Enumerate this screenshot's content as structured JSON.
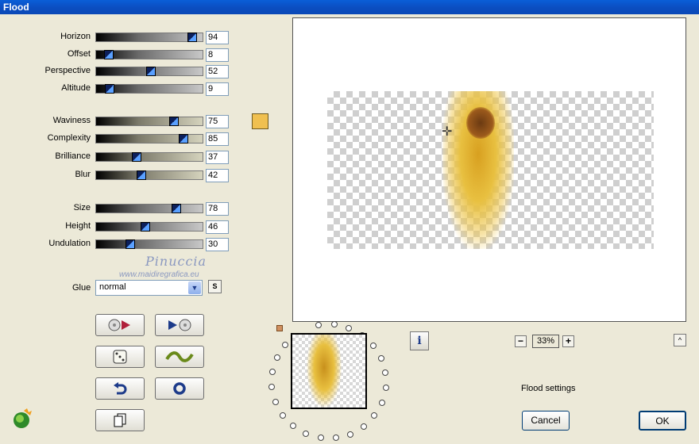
{
  "window": {
    "title": "Flood"
  },
  "sliders_group1": [
    {
      "label": "Horizon",
      "value": "94",
      "level": 0.94,
      "style": "gray"
    },
    {
      "label": "Offset",
      "value": "8",
      "level": 0.08,
      "style": "gray"
    },
    {
      "label": "Perspective",
      "value": "52",
      "level": 0.52,
      "style": "gray"
    },
    {
      "label": "Altitude",
      "value": "9",
      "level": 0.09,
      "style": "gray"
    }
  ],
  "sliders_group2": [
    {
      "label": "Waviness",
      "value": "75",
      "level": 0.75,
      "style": "tan"
    },
    {
      "label": "Complexity",
      "value": "85",
      "level": 0.85,
      "style": "tan"
    },
    {
      "label": "Brilliance",
      "value": "37",
      "level": 0.37,
      "style": "tan"
    },
    {
      "label": "Blur",
      "value": "42",
      "level": 0.42,
      "style": "tan"
    }
  ],
  "sliders_group3": [
    {
      "label": "Size",
      "value": "78",
      "level": 0.78,
      "style": "gray"
    },
    {
      "label": "Height",
      "value": "46",
      "level": 0.46,
      "style": "gray"
    },
    {
      "label": "Undulation",
      "value": "30",
      "level": 0.3,
      "style": "gray"
    }
  ],
  "color_swatch": "#f0c050",
  "watermark": {
    "name": "Pinuccia",
    "url": "www.maidiregrafica.eu"
  },
  "glue": {
    "label": "Glue",
    "value": "normal",
    "s_label": "S"
  },
  "tools": [
    {
      "name": "prev-preset-button",
      "icon": "rewind-disc-icon"
    },
    {
      "name": "next-preset-button",
      "icon": "play-disc-icon"
    },
    {
      "name": "random-button",
      "icon": "dice-icon"
    },
    {
      "name": "wave-button",
      "icon": "wave-icon"
    },
    {
      "name": "undo-button",
      "icon": "undo-arrow-icon"
    },
    {
      "name": "reset-button",
      "icon": "ring-icon"
    },
    {
      "name": "copy-button",
      "icon": "copy-pages-icon"
    }
  ],
  "zoom": {
    "value": "33%",
    "minus": "−",
    "plus": "+"
  },
  "expand_label": "^",
  "info_label": "i",
  "status": "Flood settings",
  "buttons": {
    "cancel": "Cancel",
    "ok": "OK"
  }
}
